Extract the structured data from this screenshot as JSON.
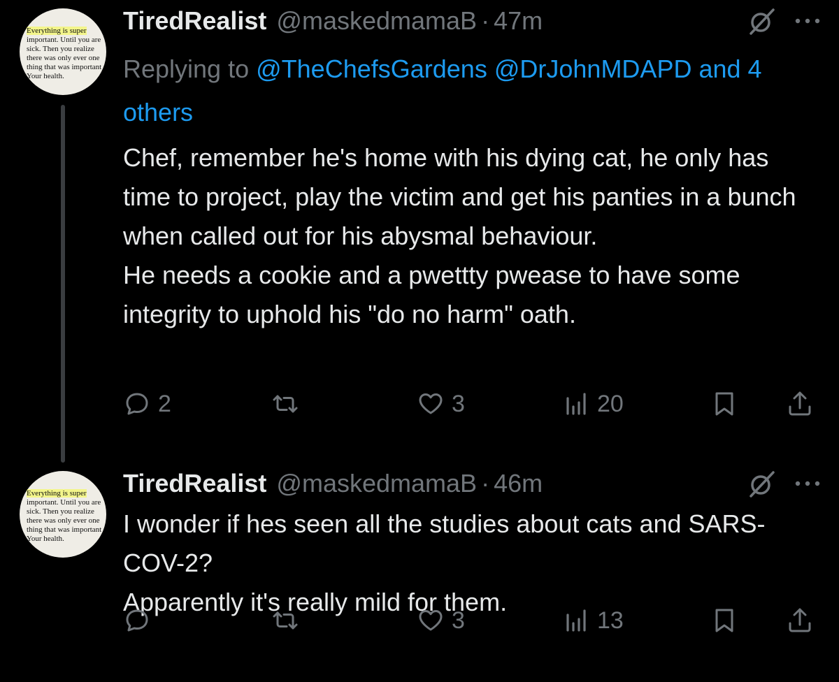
{
  "avatar": {
    "lines": [
      "Everything is super",
      "important. Until you are",
      "sick. Then you realize",
      "there was only ever one",
      "thing that was important",
      "Your health."
    ]
  },
  "tweets": [
    {
      "display_name": "TiredRealist",
      "handle": "@maskedmamaB",
      "separator": "·",
      "time": "47m",
      "reply_prefix": "Replying to",
      "mentions": [
        "@TheChefsGardens",
        "@DrJohnMDAPD",
        "and 4 others"
      ],
      "body": [
        "Chef, remember he's home with his dying cat, he only has time to project, play the victim and get his panties in a bunch when called out for his abysmal behaviour.",
        "He needs a cookie and a pwettty pwease to have some integrity to uphold his \"do no harm\" oath."
      ],
      "actions": {
        "replies": "2",
        "reposts": "",
        "likes": "3",
        "views": "20"
      }
    },
    {
      "display_name": "TiredRealist",
      "handle": "@maskedmamaB",
      "separator": "·",
      "time": "46m",
      "body": [
        "I wonder if hes seen all the studies about cats and SARS-COV-2?",
        "Apparently it's really mild for them."
      ],
      "actions": {
        "replies": "",
        "reposts": "",
        "likes": "3",
        "views": "13"
      }
    }
  ],
  "icons": {
    "reply": "reply-icon",
    "repost": "repost-icon",
    "like": "heart-icon",
    "views": "views-icon",
    "bookmark": "bookmark-icon",
    "share": "share-icon",
    "grok": "grok-icon",
    "more": "more-icon"
  },
  "colors": {
    "background": "#000000",
    "text": "#e7e9ea",
    "muted": "#71767b",
    "link": "#1d9bf0",
    "thread_line": "#3a3d40"
  }
}
